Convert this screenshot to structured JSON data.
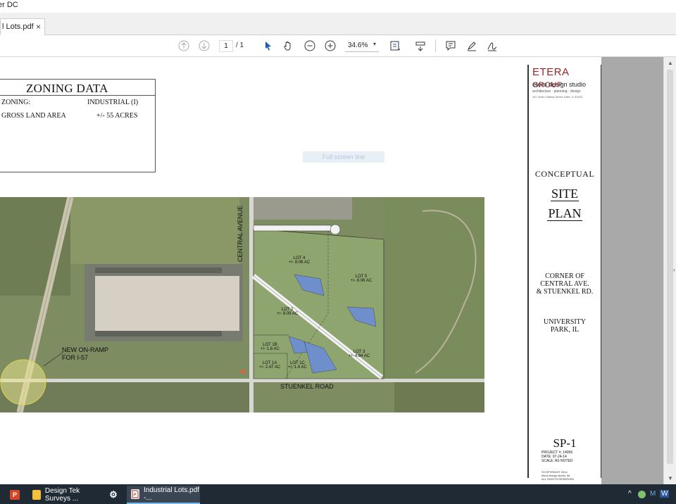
{
  "window": {
    "title_fragment": "er DC"
  },
  "tabs": [
    {
      "label": "l Lots.pdf",
      "close": "×"
    }
  ],
  "toolbar": {
    "page_current": "1",
    "page_total": "/ 1",
    "zoom": "34.6%",
    "zoom_dropdown": "▾",
    "icons": [
      "prev-page-icon",
      "next-page-icon",
      "select-arrow-icon",
      "hand-icon",
      "zoom-out-icon",
      "zoom-in-icon",
      "fit-page-icon",
      "scroll-mode-icon",
      "comment-icon",
      "highlight-icon",
      "sign-icon"
    ]
  },
  "document": {
    "zoning": {
      "title": "ZONING DATA",
      "zoning_label": "ZONING:",
      "zoning_value": "INDUSTRIAL (I)",
      "area_label": "GROSS LAND AREA",
      "area_value": "+/- 55 ACRES"
    },
    "fullscreen_hint": "Full screen line",
    "map": {
      "road_central": "CENTRAL AVENUE",
      "road_stuenkel": "STUENKEL ROAD",
      "ramp_line1": "NEW ON-RAMP",
      "ramp_line2": "FOR I-57",
      "lots": [
        {
          "name": "LOT 4",
          "area": "+/- 8.06 AC"
        },
        {
          "name": "LOT 5",
          "area": "+/- 8.06 AC"
        },
        {
          "name": "LOT 2",
          "area": "+/- 8.09 AC"
        },
        {
          "name": "LOT 3",
          "area": "+/- 4.84 AC"
        },
        {
          "name": "LOT 1B",
          "area": "+/- 1.6 AC"
        },
        {
          "name": "LOT 1A",
          "area": "+/- 2.47 AC"
        },
        {
          "name": "LOT 1C",
          "area": "+/- 1.6 AC"
        }
      ],
      "colors": {
        "detention": "#6f8fcc",
        "lot_fill": "#8fa570",
        "road": "#f2f2f2"
      }
    },
    "title_block": {
      "logo": "ETERA",
      "logo_group": "GROUP",
      "studio": "etera design studio",
      "tagline": "architecture · planning · design",
      "address": "167 North Ottawa Street Joliet, IL 60432",
      "heading": "CONCEPTUAL",
      "site": "SITE",
      "plan": "PLAN",
      "corner1": "CORNER OF",
      "corner2": "CENTRAL AVE.",
      "corner3": "& STUENKEL RD.",
      "city1": "UNIVERSITY",
      "city2": "PARK, IL",
      "sheet": "SP-1",
      "project": "PROJECT #: 14056",
      "date": "DATE: 07-24-14",
      "scale": "SCALE: AS NOTED",
      "copyright1": "©COPYRIGHT 2014",
      "copyright2": "etera design studio, ltd",
      "copyright3": "ALL RIGHTS RESERVED"
    }
  },
  "taskbar": {
    "apps": [
      {
        "label": "",
        "icon": "P",
        "color": "#d24726"
      },
      {
        "label": "Design Tek Surveys ...",
        "icon": "",
        "color": "#f3c13a"
      },
      {
        "label": "",
        "icon": "⚙",
        "color": "#1f2a35"
      },
      {
        "label": "Industrial Lots.pdf -...",
        "icon": "",
        "color": "#e8e8e8"
      }
    ],
    "tray": [
      "^",
      "M",
      "W"
    ]
  }
}
